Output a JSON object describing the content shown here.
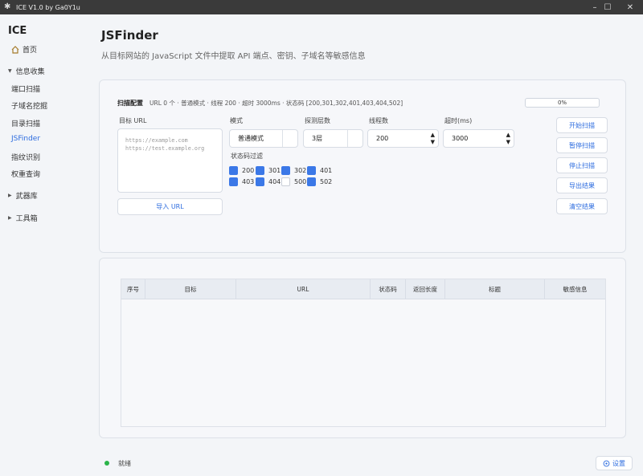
{
  "window": {
    "title": "ICE V1.0 by Ga0Y1u",
    "minimize": "–",
    "maximize": "☐",
    "close": "✕"
  },
  "sidebar": {
    "app_name": "ICE",
    "home": "首页",
    "groups": [
      {
        "label": "信息收集",
        "expanded": true
      },
      {
        "label": "武器库",
        "expanded": false
      },
      {
        "label": "工具箱",
        "expanded": false
      }
    ],
    "items": [
      "端口扫描",
      "子域名挖掘",
      "目录扫描",
      "JSFinder",
      "指纹识别",
      "权重查询"
    ],
    "active_item": "JSFinder"
  },
  "page": {
    "title": "JSFinder",
    "subtitle": "从目标网站的 JavaScript 文件中提取 API 端点、密钥、子域名等敏感信息"
  },
  "config": {
    "title": "扫描配置",
    "info": "URL 0 个 · 普通模式 · 线程 200 · 超时 3000ms · 状态码 [200,301,302,401,403,404,502]",
    "progress": "0%",
    "target_label": "目标 URL",
    "target_placeholder": "https://example.com\nhttps://test.example.org",
    "import_button": "导入 URL",
    "mode_label": "模式",
    "mode_value": "普通模式",
    "depth_label": "探测层数",
    "depth_value": "3层",
    "threads_label": "线程数",
    "threads_value": "200",
    "timeout_label": "超时(ms)",
    "timeout_value": "3000",
    "status_filter_label": "状态码过滤",
    "status_codes": [
      {
        "code": "200",
        "checked": true
      },
      {
        "code": "301",
        "checked": true
      },
      {
        "code": "302",
        "checked": true
      },
      {
        "code": "401",
        "checked": true
      },
      {
        "code": "403",
        "checked": true
      },
      {
        "code": "404",
        "checked": true
      },
      {
        "code": "500",
        "checked": false
      },
      {
        "code": "502",
        "checked": true
      }
    ]
  },
  "actions": {
    "start": "开始扫描",
    "pause": "暂停扫描",
    "stop": "停止扫描",
    "export": "导出结果",
    "clear": "清空结果"
  },
  "table": {
    "columns": [
      "序号",
      "目标",
      "URL",
      "状态码",
      "返回长度",
      "标题",
      "敏感信息"
    ],
    "rows": []
  },
  "statusbar": {
    "text": "就绪",
    "settings": "设置"
  },
  "colors": {
    "accent": "#2d6cdf",
    "checkbox": "#3b78e7",
    "ready": "#2bb44a"
  }
}
